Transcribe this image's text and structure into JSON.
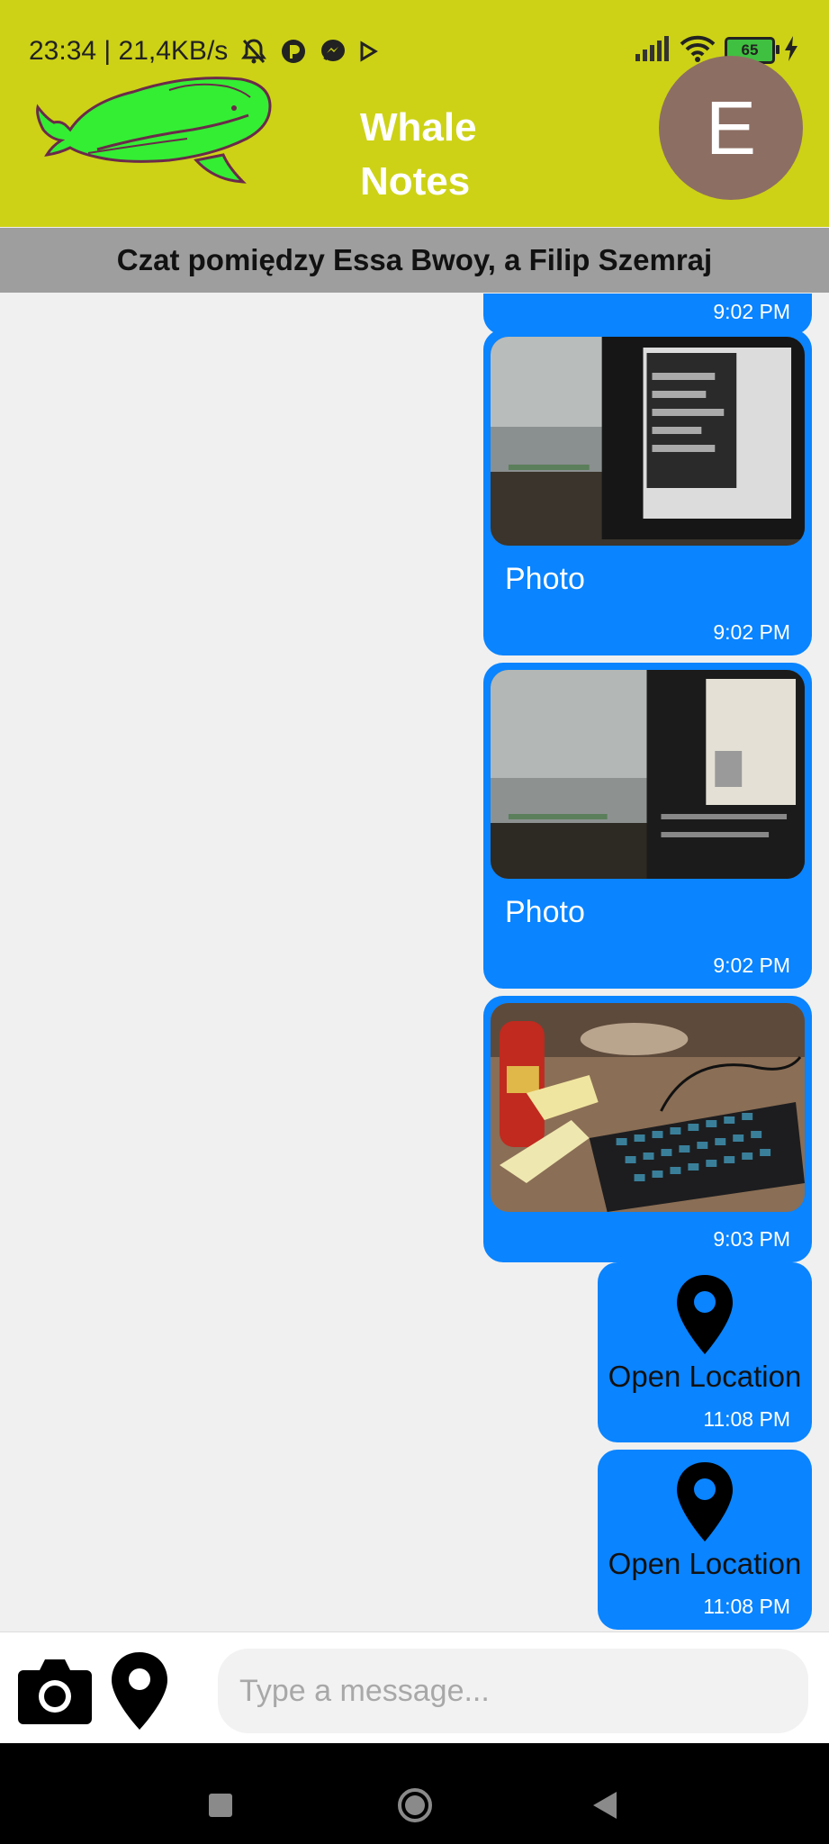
{
  "status_bar": {
    "time_and_speed": "23:34 | 21,4KB/s",
    "battery_level": "65"
  },
  "header": {
    "app_title": "Whale Notes",
    "avatar_letter": "E",
    "brand_color": "#cdd216",
    "avatar_color": "#8d6e63"
  },
  "chat": {
    "banner_title": "Czat pomiędzy Essa Bwoy, a Filip Szemraj",
    "bubble_color": "#0a84ff",
    "messages": [
      {
        "type": "partial",
        "time": "9:02 PM"
      },
      {
        "type": "photo",
        "caption": "Photo",
        "time": "9:02 PM"
      },
      {
        "type": "photo",
        "caption": "Photo",
        "time": "9:02 PM"
      },
      {
        "type": "photo",
        "time": "9:03 PM"
      },
      {
        "type": "location",
        "label": "Open Location",
        "time": "11:08 PM"
      },
      {
        "type": "location",
        "label": "Open Location",
        "time": "11:08 PM"
      }
    ]
  },
  "composer": {
    "placeholder": "Type a message...",
    "value": ""
  }
}
